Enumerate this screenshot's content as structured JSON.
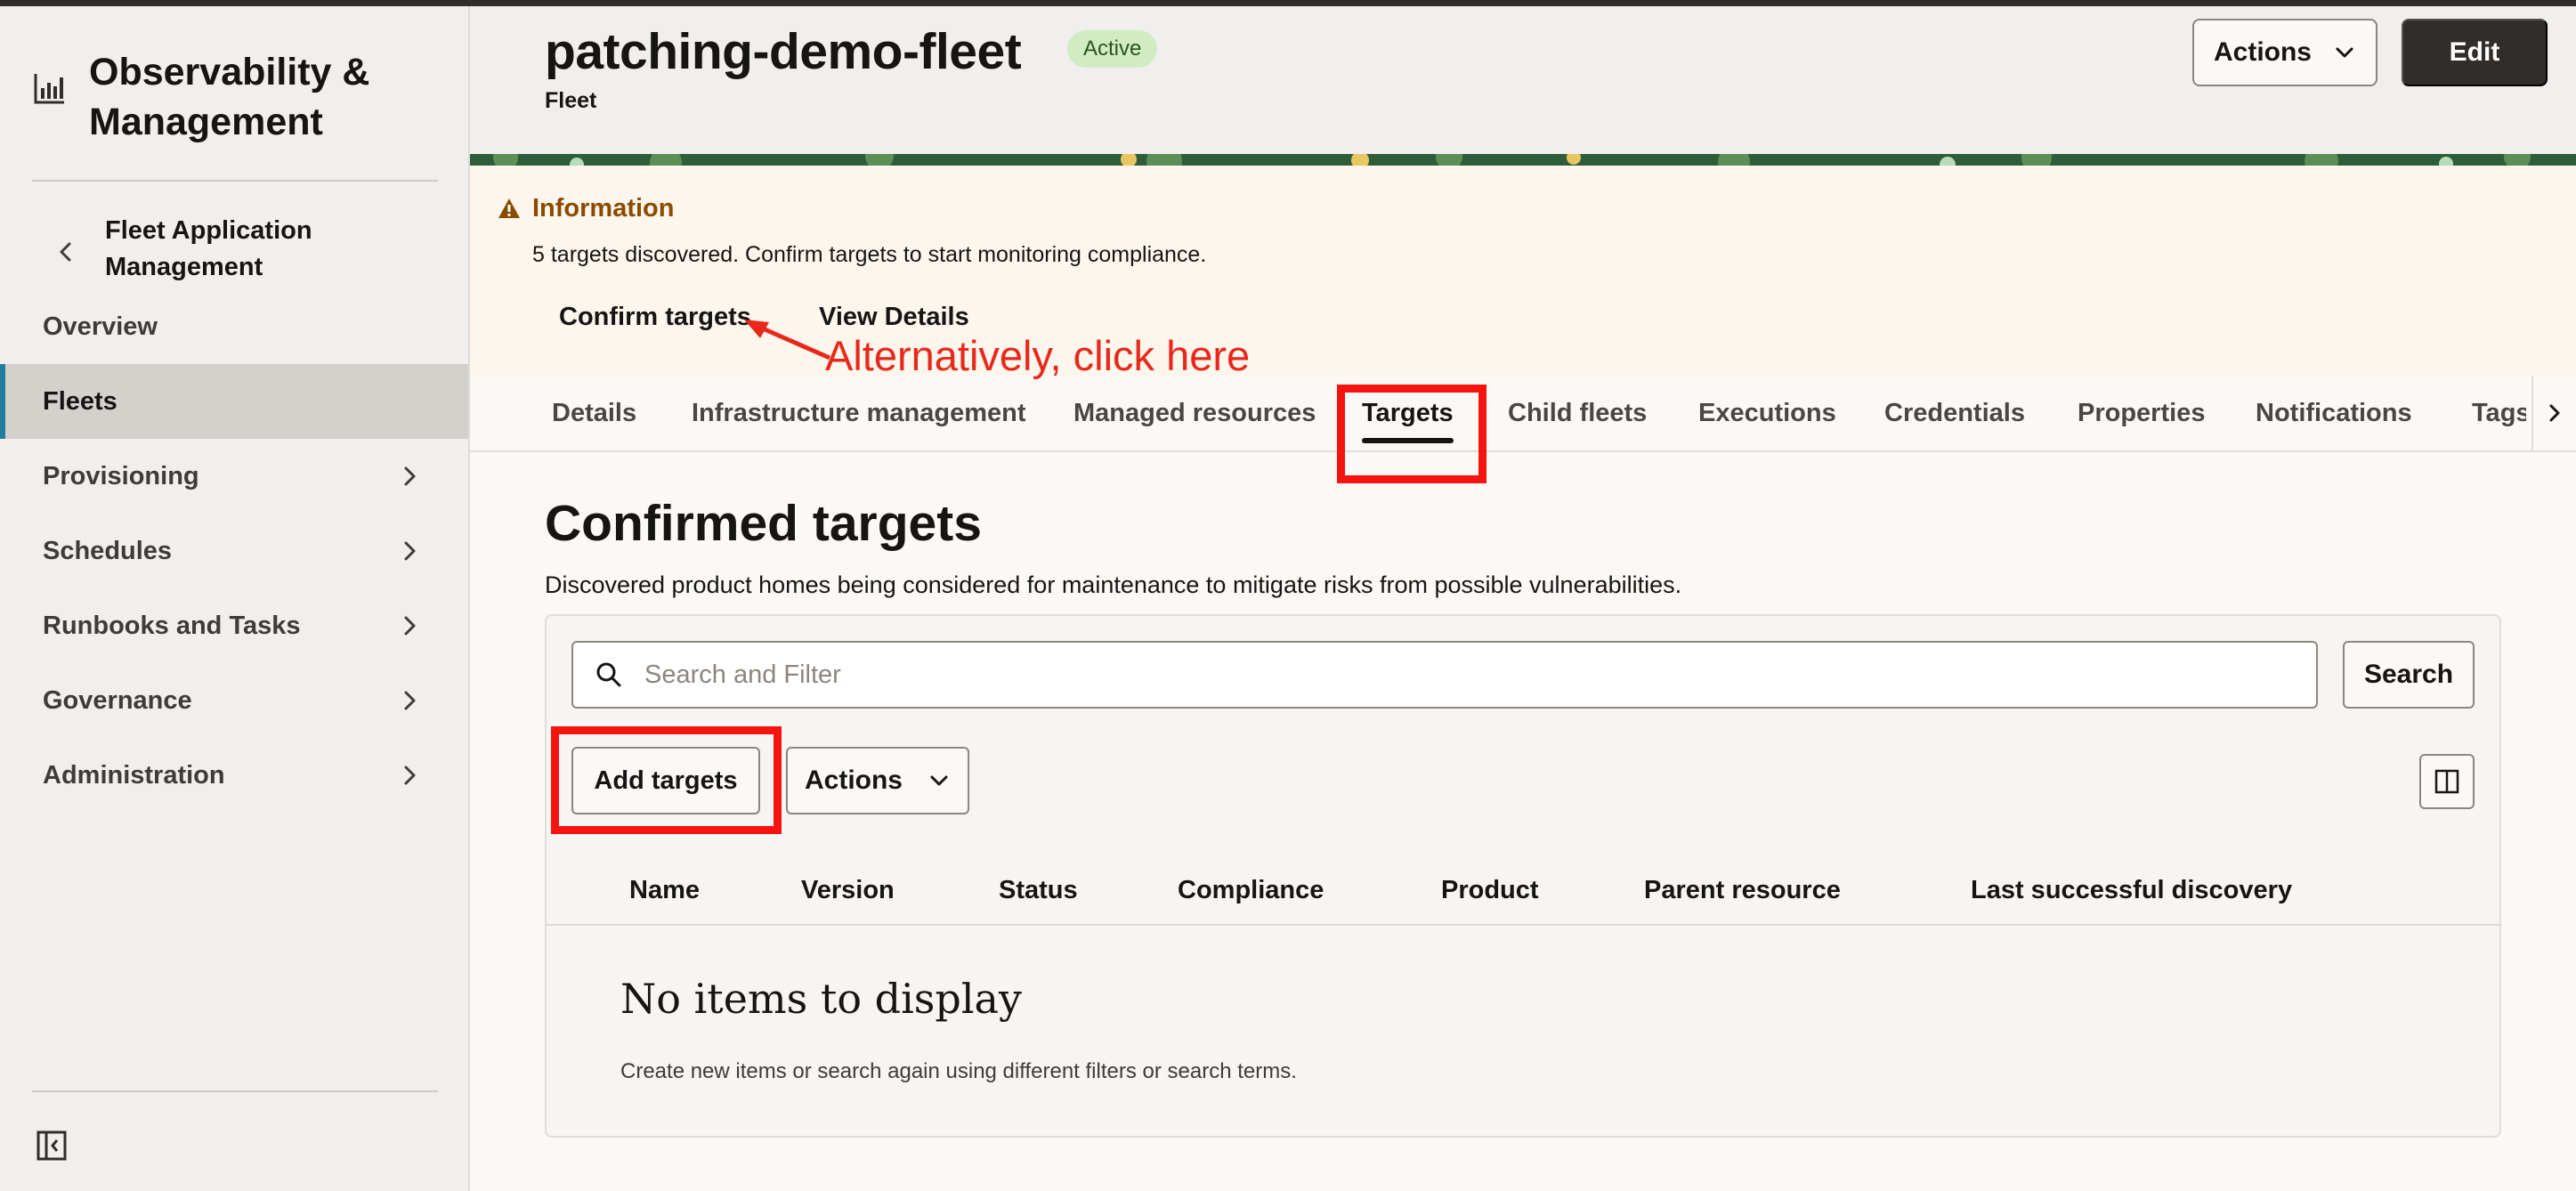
{
  "app": {
    "title": "Observability & Management",
    "logo_icon": "chart-icon"
  },
  "sidebar": {
    "back_label": "Fleet Application Management",
    "items": [
      {
        "label": "Overview",
        "selected": false,
        "has_chevron": false
      },
      {
        "label": "Fleets",
        "selected": true,
        "has_chevron": false
      },
      {
        "label": "Provisioning",
        "selected": false,
        "has_chevron": true
      },
      {
        "label": "Schedules",
        "selected": false,
        "has_chevron": true
      },
      {
        "label": "Runbooks and Tasks",
        "selected": false,
        "has_chevron": true
      },
      {
        "label": "Governance",
        "selected": false,
        "has_chevron": true
      },
      {
        "label": "Administration",
        "selected": false,
        "has_chevron": true
      }
    ],
    "selected_accent": "#227e9e"
  },
  "header": {
    "title": "patching-demo-fleet",
    "status": "Active",
    "subtitle": "Fleet",
    "actions_label": "Actions",
    "edit_label": "Edit"
  },
  "info_banner": {
    "title": "Information",
    "message": "5 targets discovered. Confirm targets to start monitoring compliance.",
    "confirm_label": "Confirm targets",
    "view_details_label": "View Details",
    "icon": "warning-icon"
  },
  "annotation": {
    "text": "Alternatively, click here",
    "color": "#e8281a"
  },
  "tabs": [
    {
      "label": "Details",
      "active": false
    },
    {
      "label": "Infrastructure management",
      "active": false
    },
    {
      "label": "Managed resources",
      "active": false
    },
    {
      "label": "Targets",
      "active": true
    },
    {
      "label": "Child fleets",
      "active": false
    },
    {
      "label": "Executions",
      "active": false
    },
    {
      "label": "Credentials",
      "active": false
    },
    {
      "label": "Properties",
      "active": false
    },
    {
      "label": "Notifications",
      "active": false
    },
    {
      "label": "Tags",
      "active": false
    }
  ],
  "main": {
    "section_title": "Confirmed targets",
    "section_description": "Discovered product homes being considered for maintenance to mitigate risks from possible vulnerabilities.",
    "search_placeholder": "Search and Filter",
    "search_button": "Search",
    "add_targets_label": "Add targets",
    "actions_label": "Actions",
    "columns": [
      "Name",
      "Version",
      "Status",
      "Compliance",
      "Product",
      "Parent resource",
      "Last successful discovery"
    ],
    "empty_title": "No items to display",
    "empty_description": "Create new items or search again using different filters or search terms."
  },
  "highlight_color": "#f5150e"
}
